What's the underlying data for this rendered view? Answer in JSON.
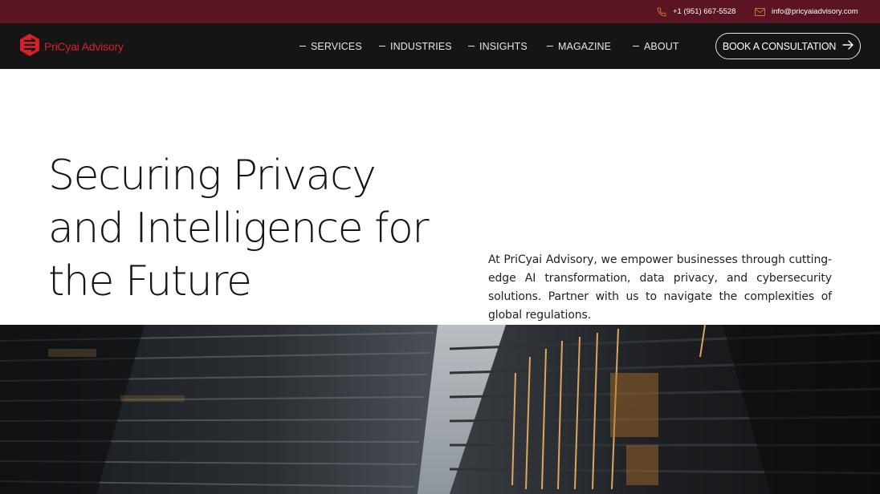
{
  "topbar": {
    "phone": "+1 (951) 667-5528",
    "email": "info@pricyaiadvisory.com",
    "phone_icon": "phone-icon",
    "email_icon": "mail-icon"
  },
  "brand": {
    "name": "PriCyai Advisory",
    "logo_icon": "pricyai-logo-icon",
    "color": "#d8202c"
  },
  "nav": {
    "items": [
      {
        "label": "SERVICES"
      },
      {
        "label": "INDUSTRIES"
      },
      {
        "label": "INSIGHTS"
      },
      {
        "label": "MAGAZINE"
      },
      {
        "label": "ABOUT"
      }
    ],
    "cta_label": "BOOK A CONSULTATION",
    "cta_icon": "arrow-right-icon"
  },
  "hero": {
    "title_lines": [
      "Securing Privacy",
      "and Intelligence for",
      "the Future"
    ],
    "description": "At PriCyai Advisory, we empower businesses through cutting-edge AI transformation, data privacy, and cybersecurity solutions. Partner with us to navigate the complexities of global regulations."
  },
  "colors": {
    "topbar_bg": "#5a1422",
    "nav_bg": "#151515",
    "accent": "#d8202c"
  }
}
